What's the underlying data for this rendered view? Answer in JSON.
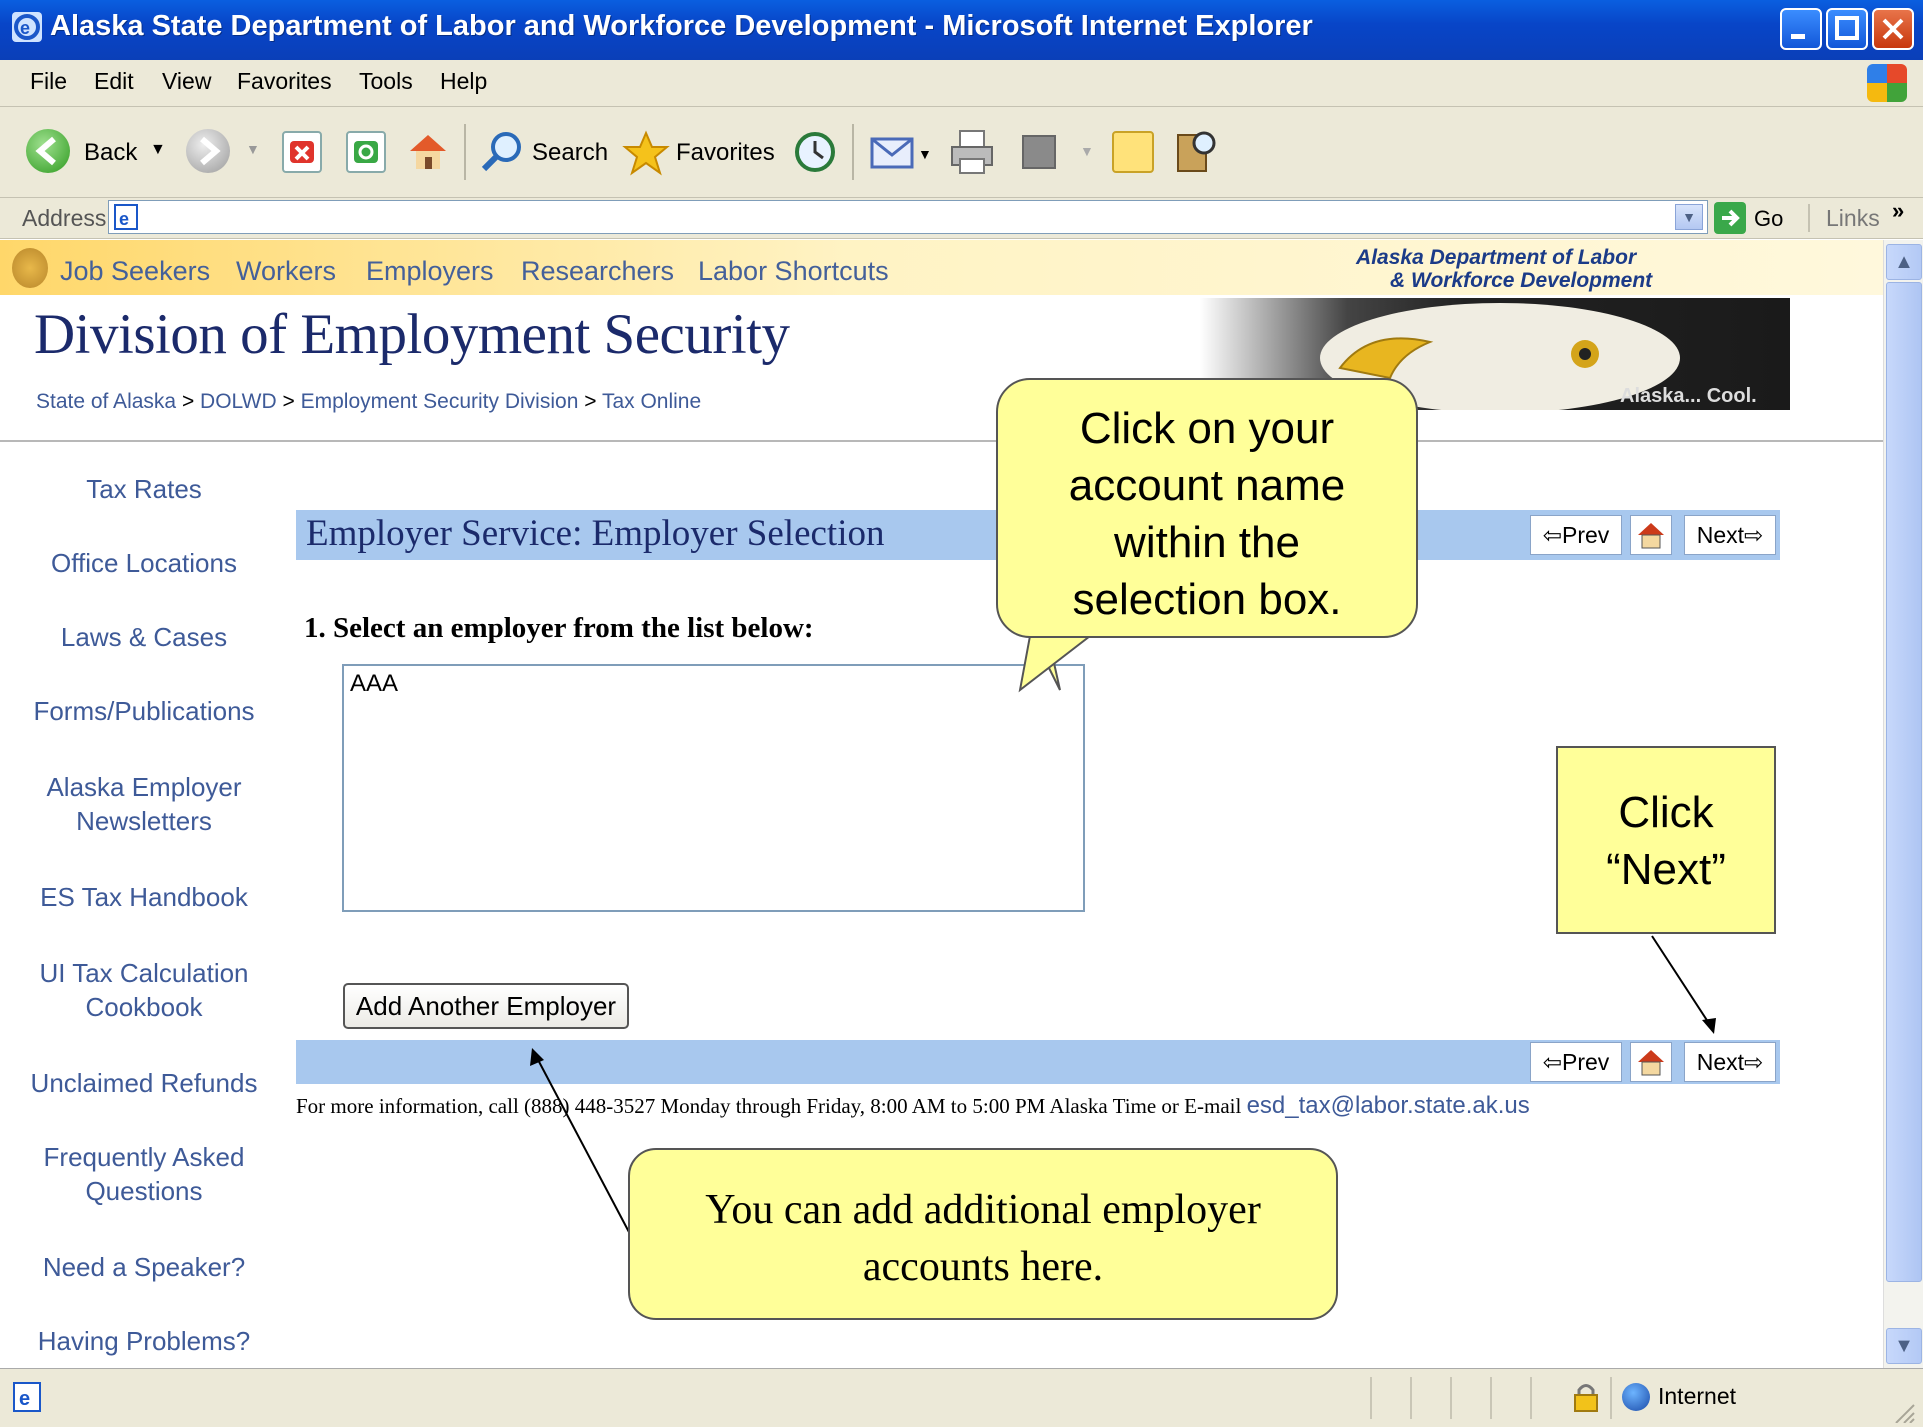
{
  "window": {
    "title": "Alaska State Department of Labor and Workforce Development - Microsoft Internet Explorer"
  },
  "menu": {
    "items": [
      "File",
      "Edit",
      "View",
      "Favorites",
      "Tools",
      "Help"
    ]
  },
  "toolbar": {
    "back_label": "Back",
    "search_label": "Search",
    "favorites_label": "Favorites"
  },
  "address": {
    "label": "Address",
    "value": "",
    "go_label": "Go",
    "links_label": "Links"
  },
  "site_nav": {
    "links": [
      "Job Seekers",
      "Workers",
      "Employers",
      "Researchers",
      "Labor Shortcuts"
    ]
  },
  "dept_logo": {
    "line1": "Alaska Department of Labor",
    "line2": "& Workforce Development"
  },
  "banner": {
    "title": "Division of Employment Security",
    "eagle_caption": "Alaska... Cool."
  },
  "breadcrumb": {
    "items": [
      "State of Alaska",
      "DOLWD",
      "Employment Security Division",
      "Tax Online"
    ],
    "separator": ">"
  },
  "sidebar": {
    "links": [
      "Tax Rates",
      "Office Locations",
      "Laws & Cases",
      "Forms/Publications",
      "Alaska Employer Newsletters",
      "ES Tax Handbook",
      "UI Tax Calculation Cookbook",
      "Unclaimed Refunds",
      "Frequently Asked Questions",
      "Need a Speaker?",
      "Having Problems?"
    ]
  },
  "main": {
    "heading": "Employer Service: Employer Selection",
    "prev_label": "Prev",
    "next_label": "Next",
    "step_text": "1.  Select an employer from the list below:",
    "employer_options": [
      "AAA"
    ],
    "add_employer_label": "Add Another Employer",
    "info_text": "For more information, call (888) 448-3527 Monday through Friday, 8:00 AM to 5:00 PM Alaska Time or E-mail",
    "info_email": "esd_tax@labor.state.ak.us"
  },
  "callouts": {
    "account_name": "Click on your account name within the selection box.",
    "next": "Click “Next”",
    "add_employer": "You can add additional employer accounts here."
  },
  "status_bar": {
    "zone_label": "Internet"
  },
  "colors": {
    "title_bar": "#0845c8",
    "chrome": "#ece9d8",
    "band": "#a8c8ee",
    "callout": "#ffff99",
    "link": "#3e5a98"
  }
}
